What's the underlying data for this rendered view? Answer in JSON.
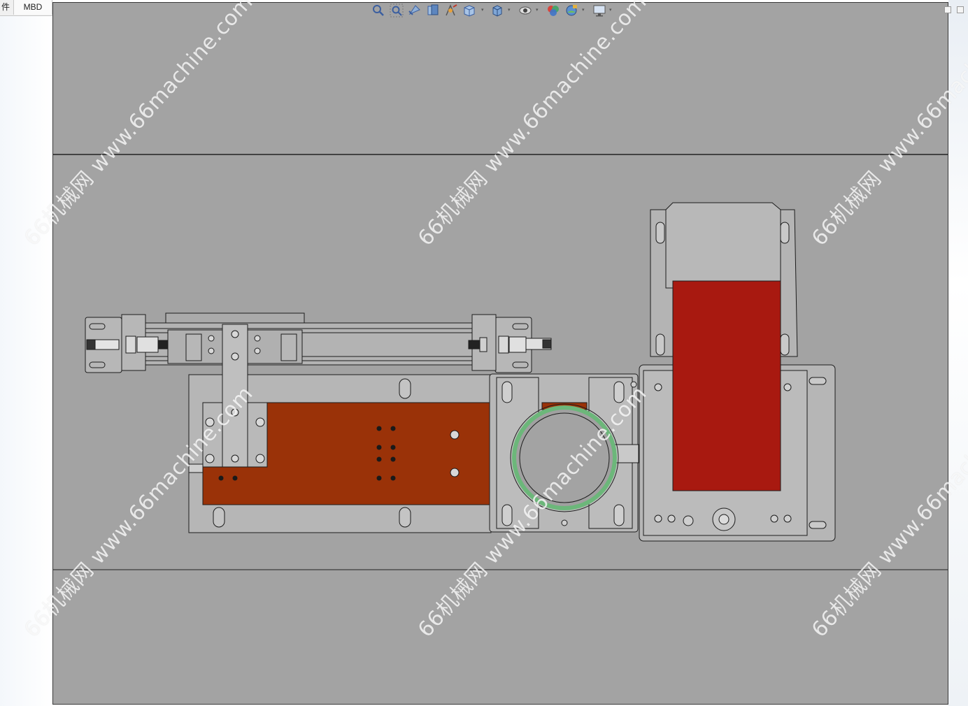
{
  "feature_tabs": [
    {
      "label": "件"
    },
    {
      "label": "MBD"
    }
  ],
  "heads_up_toolbar": [
    {
      "icon": "zoom-to-fit-icon"
    },
    {
      "icon": "zoom-to-area-icon"
    },
    {
      "icon": "previous-view-icon"
    },
    {
      "icon": "section-view-icon"
    },
    {
      "icon": "dynamic-annotation-icon"
    },
    {
      "icon": "view-orientation-icon"
    },
    {
      "icon": "display-style-icon"
    },
    {
      "icon": "hide-show-items-icon"
    },
    {
      "icon": "edit-appearance-icon"
    },
    {
      "icon": "apply-scene-icon"
    },
    {
      "icon": "view-settings-icon"
    }
  ],
  "watermark": {
    "text": "66机械网 www.66machine.com",
    "color": "#ffffff"
  },
  "colors": {
    "viewport_background": "#a3a3a3",
    "plate_rust": "#9a3208",
    "motor_red": "#a81910",
    "ring_green": "#6cb77a",
    "line": "#1c1c1c"
  }
}
